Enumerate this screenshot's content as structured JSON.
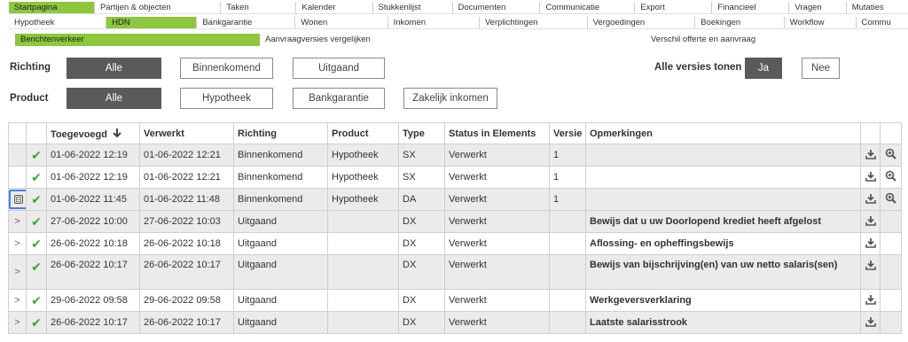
{
  "nav1": [
    "Startpagina",
    "Partijen & objecten",
    "Taken",
    "Kalender",
    "Stukkenlijst",
    "Documenten",
    "Communicatie",
    "Export",
    "Financieel",
    "Vragen",
    "Mutaties"
  ],
  "nav2": [
    "Hypotheek",
    "HDN",
    "Bankgarantie",
    "Wonen",
    "Inkomen",
    "Verplichtingen",
    "Vergoedingen",
    "Boekingen",
    "Workflow",
    "Commu"
  ],
  "nav3": [
    "Berichtenverkeer",
    "Aanvraagversies vergelijken",
    "Verschil offerte en aanvraag"
  ],
  "filters": {
    "richting_label": "Richting",
    "richting": [
      "Alle",
      "Binnenkomend",
      "Uitgaand"
    ],
    "product_label": "Product",
    "product": [
      "Alle",
      "Hypotheek",
      "Bankgarantie",
      "Zakelijk inkomen"
    ],
    "versies_label": "Alle versies tonen",
    "versies": [
      "Ja",
      "Nee"
    ]
  },
  "table": {
    "headers": [
      "Toegevoegd",
      "Verwerkt",
      "Richting",
      "Product",
      "Type",
      "Status in Elements",
      "Versie",
      "Opmerkingen"
    ],
    "rows": [
      {
        "expander": "",
        "toegevoegd": "01-06-2022 12:19",
        "verwerkt": "01-06-2022 12:21",
        "richting": "Binnenkomend",
        "product": "Hypotheek",
        "type": "SX",
        "status": "Verwerkt",
        "versie": "1",
        "opmerkingen": ""
      },
      {
        "expander": "",
        "toegevoegd": "01-06-2022 12:19",
        "verwerkt": "01-06-2022 12:21",
        "richting": "Binnenkomend",
        "product": "Hypotheek",
        "type": "SX",
        "status": "Verwerkt",
        "versie": "1",
        "opmerkingen": ""
      },
      {
        "expander": "⊟",
        "toegevoegd": "01-06-2022 11:45",
        "verwerkt": "01-06-2022 11:48",
        "richting": "Binnenkomend",
        "product": "Hypotheek",
        "type": "DA",
        "status": "Verwerkt",
        "versie": "1",
        "opmerkingen": ""
      },
      {
        "expander": ">",
        "toegevoegd": "27-06-2022 10:00",
        "verwerkt": "27-06-2022 10:03",
        "richting": "Uitgaand",
        "product": "",
        "type": "DX",
        "status": "Verwerkt",
        "versie": "",
        "opmerkingen": "Bewijs dat u uw Doorlopend krediet heeft afgelost"
      },
      {
        "expander": ">",
        "toegevoegd": "26-06-2022 10:18",
        "verwerkt": "26-06-2022 10:18",
        "richting": "Uitgaand",
        "product": "",
        "type": "DX",
        "status": "Verwerkt",
        "versie": "",
        "opmerkingen": "Aflossing- en opheffingsbewijs"
      },
      {
        "expander": ">",
        "toegevoegd": "26-06-2022 10:17",
        "verwerkt": "26-06-2022 10:17",
        "richting": "Uitgaand",
        "product": "",
        "type": "DX",
        "status": "Verwerkt",
        "versie": "",
        "opmerkingen": "Bewijs van bijschrijving(en) van uw netto salaris(sen)"
      },
      {
        "expander": ">",
        "toegevoegd": "29-06-2022 09:58",
        "verwerkt": "29-06-2022 09:58",
        "richting": "Uitgaand",
        "product": "",
        "type": "DX",
        "status": "Verwerkt",
        "versie": "",
        "opmerkingen": "Werkgeversverklaring"
      },
      {
        "expander": ">",
        "toegevoegd": "26-06-2022 10:17",
        "verwerkt": "26-06-2022 10:17",
        "richting": "Uitgaand",
        "product": "",
        "type": "DX",
        "status": "Verwerkt",
        "versie": "",
        "opmerkingen": "Laatste salarisstrook"
      }
    ]
  },
  "icons": {
    "check": "✔",
    "download": "download-icon",
    "zoom": "zoom-in-icon",
    "sort": "arrow-down-icon"
  },
  "colors": {
    "nav_active": "#8dc63f",
    "button_active": "#5a5a5a",
    "check": "#3aa53a",
    "highlight": "#4a7fe0"
  }
}
